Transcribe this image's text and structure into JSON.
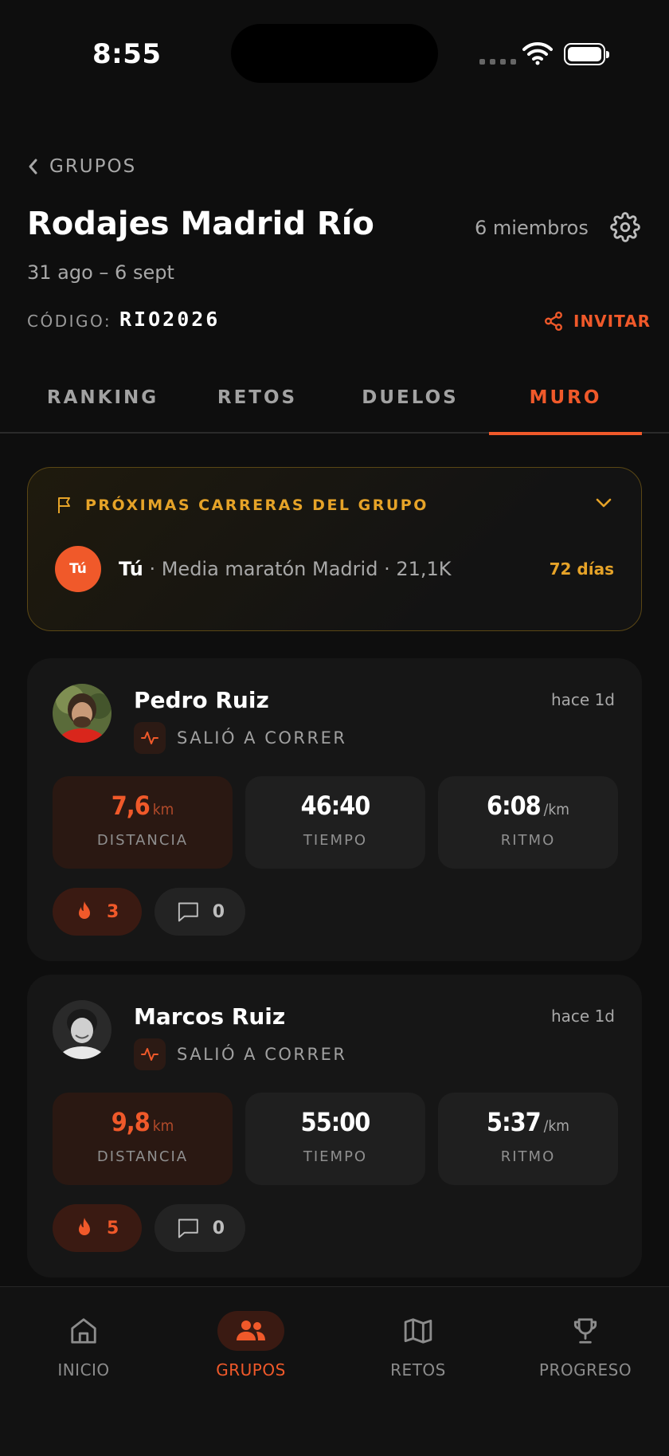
{
  "status_bar": {
    "time": "8:55"
  },
  "header": {
    "back_label": "GRUPOS",
    "title": "Rodajes Madrid Río",
    "members": "6 miembros",
    "dates": "31 ago – 6 sept",
    "code_label": "CÓDIGO:",
    "code_value": "RIO2026",
    "invite_label": "INVITAR"
  },
  "tabs": [
    {
      "label": "RANKING"
    },
    {
      "label": "RETOS"
    },
    {
      "label": "DUELOS"
    },
    {
      "label": "MURO",
      "active": true
    }
  ],
  "upcoming": {
    "title": "PRÓXIMAS CARRERAS DEL GRUPO",
    "items": [
      {
        "avatar": "Tú",
        "who": "Tú",
        "detail": " · Media maratón Madrid · 21,1K",
        "days": "72 días"
      }
    ]
  },
  "feed": [
    {
      "name": "Pedro Ruiz",
      "ago": "hace 1d",
      "activity": "SALIÓ A CORRER",
      "stats": [
        {
          "value": "7,6",
          "unit": "km",
          "label": "DISTANCIA"
        },
        {
          "value": "46:40",
          "unit": "",
          "label": "TIEMPO"
        },
        {
          "value": "6:08",
          "unit": "/km",
          "label": "RITMO"
        }
      ],
      "fire_count": "3",
      "comment_count": "0"
    },
    {
      "name": "Marcos Ruiz",
      "ago": "hace 1d",
      "activity": "SALIÓ A CORRER",
      "stats": [
        {
          "value": "9,8",
          "unit": "km",
          "label": "DISTANCIA"
        },
        {
          "value": "55:00",
          "unit": "",
          "label": "TIEMPO"
        },
        {
          "value": "5:37",
          "unit": "/km",
          "label": "RITMO"
        }
      ],
      "fire_count": "5",
      "comment_count": "0"
    }
  ],
  "bottom_nav": [
    {
      "label": "INICIO",
      "icon": "home-icon"
    },
    {
      "label": "GRUPOS",
      "icon": "users-icon",
      "active": true
    },
    {
      "label": "RETOS",
      "icon": "map-icon"
    },
    {
      "label": "PROGRESO",
      "icon": "trophy-icon"
    }
  ],
  "colors": {
    "accent": "#f0592a",
    "gold": "#e6a328",
    "background": "#0e0e0e",
    "card": "#161616"
  }
}
